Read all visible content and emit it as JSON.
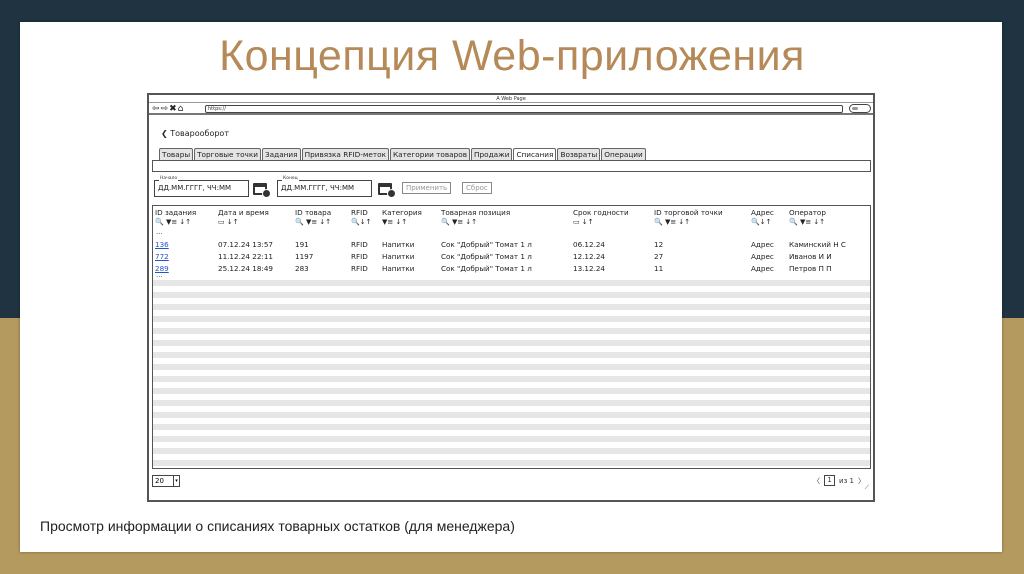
{
  "slide": {
    "title": "Концепция Web-приложения",
    "caption": "Просмотр информации о списаниях товарных остатков (для менеджера)"
  },
  "window": {
    "title": "A Web Page",
    "url": "https://",
    "nav_icons": "⇦⇨✖⌂"
  },
  "breadcrumb": {
    "back_icon": "chevron-left-icon",
    "label": "Товарооборот"
  },
  "tabs": [
    {
      "label": "Товары",
      "active": false
    },
    {
      "label": "Торговые точки",
      "active": false
    },
    {
      "label": "Задания",
      "active": false
    },
    {
      "label": "Привязка RFID-меток",
      "active": false
    },
    {
      "label": "Категории товаров",
      "active": false
    },
    {
      "label": "Продажи",
      "active": false
    },
    {
      "label": "Списания",
      "active": true
    },
    {
      "label": "Возвраты",
      "active": false
    },
    {
      "label": "Операции",
      "active": false
    }
  ],
  "filters": {
    "start_label": "Начало",
    "start_placeholder": "ДД.ММ.ГГГГ, ЧЧ:ММ",
    "end_label": "Конец",
    "end_placeholder": "ДД.ММ.ГГГГ, ЧЧ:ММ",
    "apply_label": "Применить",
    "reset_label": "Сброс"
  },
  "table": {
    "columns": [
      "ID задания",
      "Дата и время",
      "ID товара",
      "RFID",
      "Категория",
      "Товарная позиция",
      "Срок годности",
      "ID торговой точки",
      "Адрес",
      "Оператор"
    ],
    "controls": [
      "🔍 ▼≡ ↓↑",
      "▭ ↓↑",
      "🔍 ▼≡ ↓↑",
      "🔍↓↑",
      "▼≡ ↓↑",
      "🔍 ▼≡ ↓↑",
      "▭ ↓↑",
      "🔍 ▼≡ ↓↑",
      "🔍↓↑",
      "🔍 ▼≡ ↓↑"
    ],
    "top_ellipsis": "...",
    "bottom_ellipsis": "...",
    "rows": [
      [
        "136",
        "07.12.24 13:57",
        "191",
        "RFID",
        "Напитки",
        "Сок \"Добрый\" Томат 1 л",
        "06.12.24",
        "12",
        "Адрес",
        "Каминский Н С"
      ],
      [
        "772",
        "11.12.24 22:11",
        "1197",
        "RFID",
        "Напитки",
        "Сок \"Добрый\" Томат 1 л",
        "12.12.24",
        "27",
        "Адрес",
        "Иванов И И"
      ],
      [
        "289",
        "25.12.24 18:49",
        "283",
        "RFID",
        "Напитки",
        "Сок \"Добрый\" Томат 1 л",
        "13.12.24",
        "11",
        "Адрес",
        "Петров П П"
      ]
    ]
  },
  "pagination": {
    "page_size": "20",
    "current_page": "1",
    "of_text": "из 1",
    "prev": "〈",
    "next": "〉"
  }
}
